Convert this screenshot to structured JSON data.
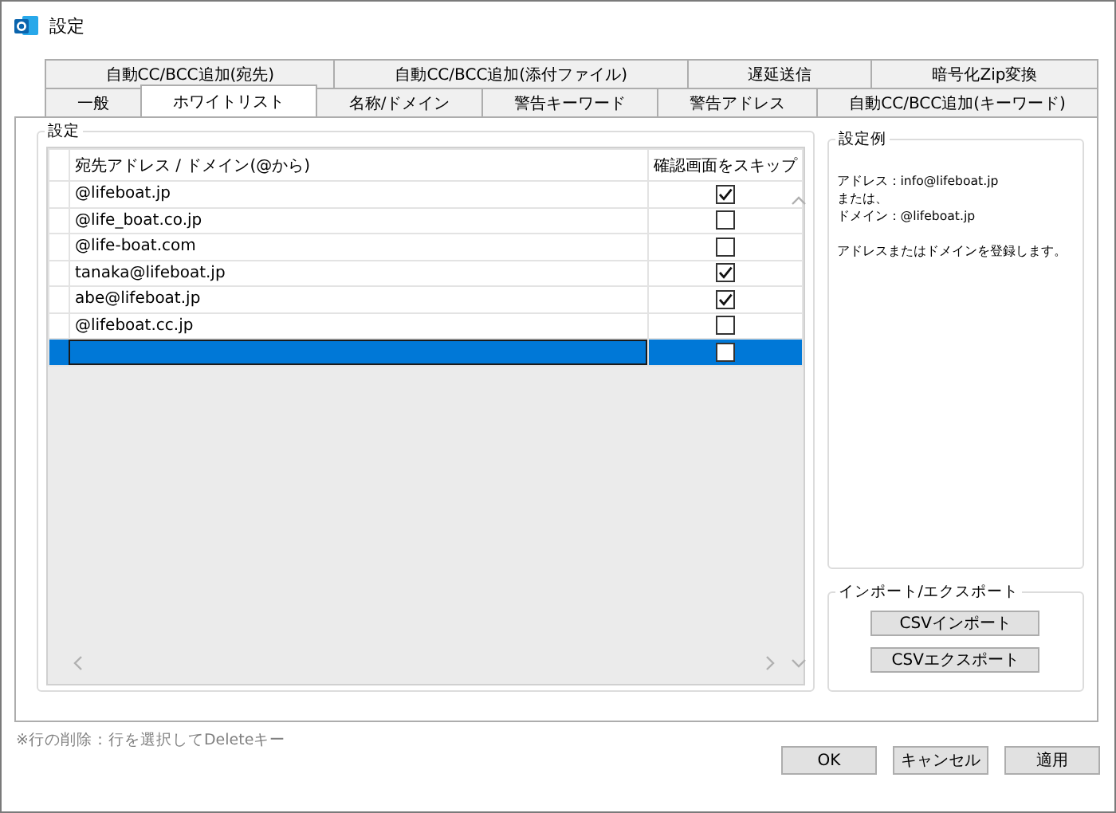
{
  "window": {
    "title": "設定"
  },
  "tab_rows": [
    [
      {
        "label": "自動CC/BCC追加(宛先)",
        "selected": false
      },
      {
        "label": "自動CC/BCC追加(添付ファイル)",
        "selected": false
      },
      {
        "label": "遅延送信",
        "selected": false
      },
      {
        "label": "暗号化Zip変換",
        "selected": false
      }
    ],
    [
      {
        "label": "一般",
        "selected": false
      },
      {
        "label": "ホワイトリスト",
        "selected": true
      },
      {
        "label": "名称/ドメイン",
        "selected": false
      },
      {
        "label": "警告キーワード",
        "selected": false
      },
      {
        "label": "警告アドレス",
        "selected": false
      },
      {
        "label": "自動CC/BCC追加(キーワード)",
        "selected": false
      }
    ]
  ],
  "settings_group": {
    "title": "設定",
    "table": {
      "columns": [
        "宛先アドレス / ドメイン(@から)",
        "確認画面をスキップ"
      ],
      "rows": [
        {
          "address": "@lifeboat.jp",
          "skip": true,
          "selected": false
        },
        {
          "address": "@life_boat.co.jp",
          "skip": false,
          "selected": false
        },
        {
          "address": "@life-boat.com",
          "skip": false,
          "selected": false
        },
        {
          "address": "tanaka@lifeboat.jp",
          "skip": true,
          "selected": false
        },
        {
          "address": "abe@lifeboat.jp",
          "skip": true,
          "selected": false
        },
        {
          "address": "@lifeboat.cc.jp",
          "skip": false,
          "selected": false
        },
        {
          "address": "",
          "skip": false,
          "selected": true
        }
      ]
    }
  },
  "example_group": {
    "title": "設定例",
    "paragraphs": [
      [
        "アドレス：info@lifeboat.jp",
        "または、",
        "ドメイン：@lifeboat.jp"
      ],
      [
        "アドレスまたはドメインを登録します。"
      ]
    ]
  },
  "import_export_group": {
    "title": "インポート/エクスポート",
    "buttons": [
      "CSVインポート",
      "CSVエクスポート"
    ]
  },
  "note": "※行の削除：行を選択してDeleteキー",
  "buttons": [
    "OK",
    "キャンセル",
    "適用"
  ]
}
